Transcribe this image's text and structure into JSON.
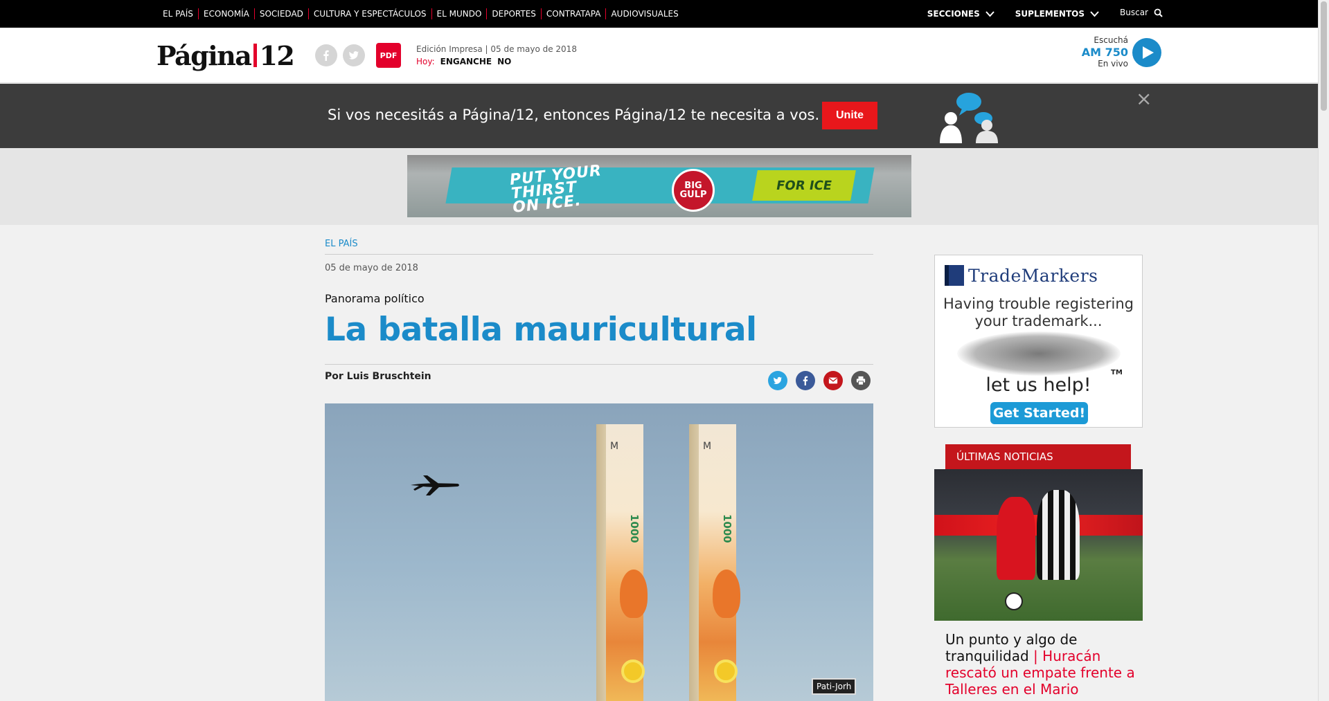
{
  "topnav": {
    "sections": [
      "EL PAÍS",
      "ECONOMÍA",
      "SOCIEDAD",
      "CULTURA Y ESPECTÁCULOS",
      "EL MUNDO",
      "DEPORTES",
      "CONTRATAPA",
      "AUDIOVISUALES"
    ],
    "secciones_label": "SECCIONES",
    "suplementos_label": "SUPLEMENTOS",
    "search_label": "Buscar"
  },
  "header": {
    "logo_left": "Página",
    "logo_right": "12",
    "pdf_label": "PDF",
    "edition_text": "Edición Impresa | 05 de mayo de 2018",
    "hoy_label": "Hoy:",
    "hoy_tags": [
      "ENGANCHE",
      "NO"
    ],
    "radio": {
      "escucha": "Escuchá",
      "station": "AM 750",
      "envivo": "En vivo"
    }
  },
  "banner": {
    "message": "Si vos necesitás a Página/12, entonces Página/12 te necesita a vos.",
    "button_label": "Unite",
    "close_symbol": "×"
  },
  "ad_top": {
    "slogan_line1": "PUT YOUR",
    "slogan_line2": "THIRST",
    "slogan_line3": "ON ICE.",
    "cup_text": "BIG GULP",
    "green_text": "FOR ICE"
  },
  "article": {
    "section": "EL PAÍS",
    "date": "05 de mayo de 2018",
    "kicker": "Panorama político",
    "headline": "La batalla mauricultural",
    "byline": "Por Luis Bruschtein",
    "image_signature": "Pati-Jorh",
    "banknote_value": "1000",
    "banknote_letter": "M"
  },
  "sidebar": {
    "ad": {
      "brand": "TradeMarkers",
      "line1": "Having trouble registering",
      "line2": "your trademark...",
      "help": "let us help!",
      "tm": "TM",
      "cta": "Get Started!"
    },
    "ultimas_label": "ÚLTIMAS NOTICIAS",
    "news": {
      "title_black": "Un punto y algo de tranquilidad",
      "separator": "|",
      "title_red": "Huracán rescató un empate frente a Talleres en el Mario"
    }
  },
  "colors": {
    "accent_blue": "#1b8bc9",
    "brand_red": "#e3002b",
    "banner_bg": "#3c3c3c"
  }
}
